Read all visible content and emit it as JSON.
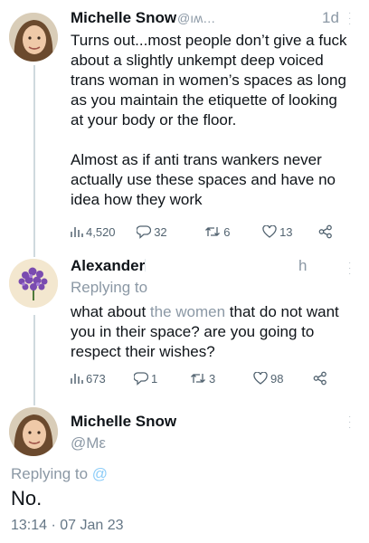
{
  "colors": {
    "link": "#8ecdf8",
    "muted": "#8b98a5",
    "text": "#0f1419",
    "thread": "#cfd9de"
  },
  "tweet1": {
    "name": "Michelle Snow",
    "handle": "@ıʍ…",
    "time": "1d",
    "body": "Turns out...most people don’t give a fuck about a slightly unkempt deep voiced trans woman in women’s spaces as long as you maintain the etiquette of looking at your body or the floor.\n\nAlmost as if anti trans wankers never actually use these spaces and have no idea how they work",
    "views": "4,520",
    "replies": "32",
    "retweets": "6",
    "likes": "13",
    "icons": [
      "views-icon",
      "reply-icon",
      "retweet-icon",
      "like-icon",
      "share-icon"
    ]
  },
  "tweet2": {
    "name": "Alexander",
    "time": "h",
    "replying_prefix": "Replying to",
    "body_pre": "what about ",
    "body_faded": "the women",
    "body_post": " that do not want you in their space? are you going to respect their wishes?",
    "views": "673",
    "replies": "1",
    "retweets": "3",
    "likes": "98"
  },
  "main": {
    "name": "Michelle Snow",
    "handle": "@Mε",
    "replying_prefix": "Replying to",
    "replying_handle": "@",
    "body": "No.",
    "timestamp": "13:14 · 07 Jan 23"
  }
}
